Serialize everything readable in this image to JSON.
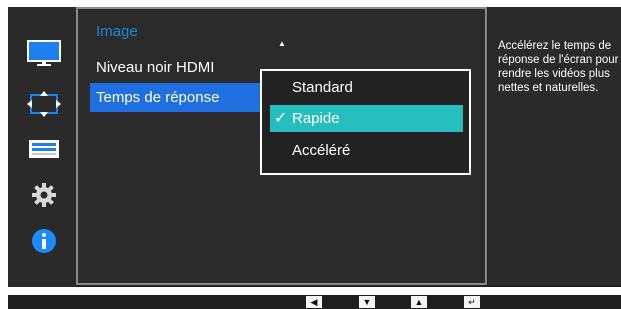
{
  "menu": {
    "title": "Image",
    "items": [
      {
        "label": "Niveau noir HDMI"
      },
      {
        "label": "Temps de réponse"
      }
    ],
    "scroll_up_icon": "triangle-up-icon"
  },
  "dropdown": {
    "options": [
      {
        "label": "Standard"
      },
      {
        "label": "Rapide"
      },
      {
        "label": "Accéléré"
      }
    ],
    "selected": "Rapide",
    "selected_color": "#26bdbd"
  },
  "description": "Accélérez le temps de réponse de l'écran pour rendre les vidéos plus nettes et naturelles.",
  "sidebar_icons": [
    "monitor-icon",
    "picture-size-icon",
    "settings-bars-icon",
    "gear-icon",
    "info-icon"
  ],
  "nav_buttons": [
    "left-arrow-icon",
    "down-arrow-icon",
    "up-arrow-icon",
    "enter-icon"
  ],
  "colors": {
    "title": "#1e86d8",
    "menu_selected": "#1f6fe0",
    "info": "#1a8cff"
  }
}
